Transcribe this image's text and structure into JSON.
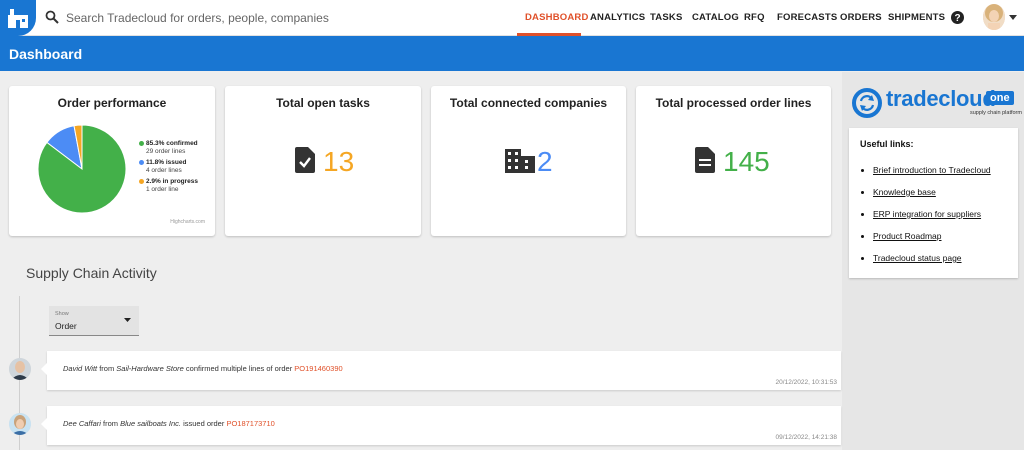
{
  "search": {
    "placeholder": "Search Tradecloud for orders, people, companies"
  },
  "nav": {
    "items": [
      {
        "label": "DASHBOARD"
      },
      {
        "label": "ANALYTICS"
      },
      {
        "label": "TASKS"
      },
      {
        "label": "CATALOG"
      },
      {
        "label": "RFQ"
      },
      {
        "label": "FORECASTS"
      },
      {
        "label": "ORDERS"
      },
      {
        "label": "SHIPMENTS"
      }
    ],
    "active_color": "#e0512a"
  },
  "header": {
    "title": "Dashboard",
    "color": "#1976d2"
  },
  "cards": {
    "order_performance": {
      "title": "Order performance",
      "legend": [
        {
          "label": "85.3% confirmed",
          "sub": "29 order lines",
          "color": "#43b049"
        },
        {
          "label": "11.8% issued",
          "sub": "4 order lines",
          "color": "#4c8cf5"
        },
        {
          "label": "2.9% in progress",
          "sub": "1 order line",
          "color": "#f5a623"
        }
      ],
      "credit": "Highcharts.com"
    },
    "open_tasks": {
      "title": "Total open tasks",
      "value": "13",
      "color": "#f5a623"
    },
    "connected_companies": {
      "title": "Total connected companies",
      "value": "2",
      "color": "#4c8cf5"
    },
    "processed_lines": {
      "title": "Total processed order lines",
      "value": "145",
      "color": "#43b049"
    }
  },
  "chart_data": {
    "type": "pie",
    "categories": [
      "confirmed",
      "issued",
      "in progress"
    ],
    "values": [
      85.3,
      11.8,
      2.9
    ],
    "order_lines": [
      29,
      4,
      1
    ],
    "colors": [
      "#43b049",
      "#4c8cf5",
      "#f5a623"
    ],
    "title": "Order performance",
    "legend_position": "right"
  },
  "brand": {
    "name": "tradecloud",
    "badge": "one",
    "tagline": "supply chain platform"
  },
  "useful_links": {
    "title": "Useful links:",
    "items": [
      {
        "label": "Brief introduction to Tradecloud"
      },
      {
        "label": "Knowledge base"
      },
      {
        "label": "ERP integration for suppliers"
      },
      {
        "label": "Product Roadmap"
      },
      {
        "label": "Tradecloud status page"
      }
    ]
  },
  "activity": {
    "title": "Supply Chain Activity",
    "filter": {
      "label": "Show",
      "value": "Order"
    },
    "entries": [
      {
        "person": "David Witt",
        "from": " from ",
        "company": "Sail-Hardware Store",
        "action": " confirmed multiple lines of order ",
        "po": "PO191460390",
        "time": "20/12/2022, 10:31:53"
      },
      {
        "person": "Dee Caffari",
        "from": " from ",
        "company": "Blue sailboats Inc.",
        "action": " issued order ",
        "po": "PO187173710",
        "time": "09/12/2022, 14:21:38"
      }
    ]
  }
}
